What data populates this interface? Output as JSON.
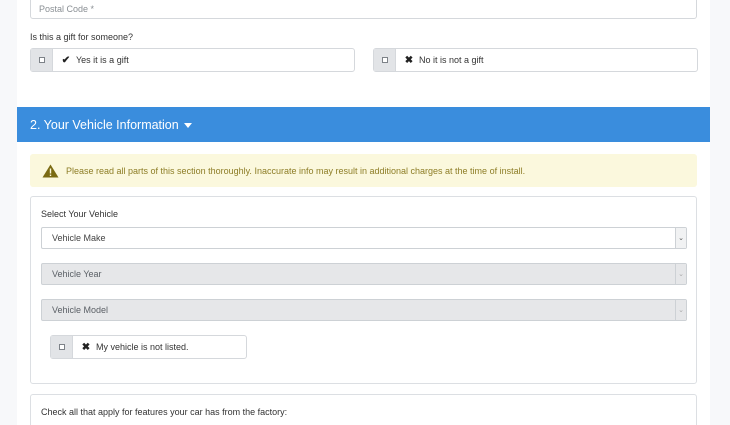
{
  "postal": {
    "placeholder": "Postal Code *"
  },
  "gift": {
    "question": "Is this a gift for someone?",
    "yes_label": "Yes it is a gift",
    "no_label": "No it is not a gift",
    "yes_mark": "✔",
    "no_mark": "✖"
  },
  "section": {
    "title": "2. Your Vehicle Information"
  },
  "alert": {
    "text": "Please read all parts of this section thoroughly. Inaccurate info may result in additional charges at the time of install.",
    "icon": "warning-icon"
  },
  "vehicle": {
    "heading": "Select Your Vehicle",
    "make": "Vehicle Make",
    "year": "Vehicle Year",
    "model": "Vehicle Model",
    "not_listed": "My vehicle is not listed.",
    "not_listed_mark": "✖",
    "arrow": "⌄"
  },
  "features": {
    "heading": "Check all that apply for features your car has from the factory:"
  },
  "colors": {
    "accent": "#3a8ddd",
    "alert_bg": "#fbf8dd",
    "alert_text": "#8d7d26"
  }
}
